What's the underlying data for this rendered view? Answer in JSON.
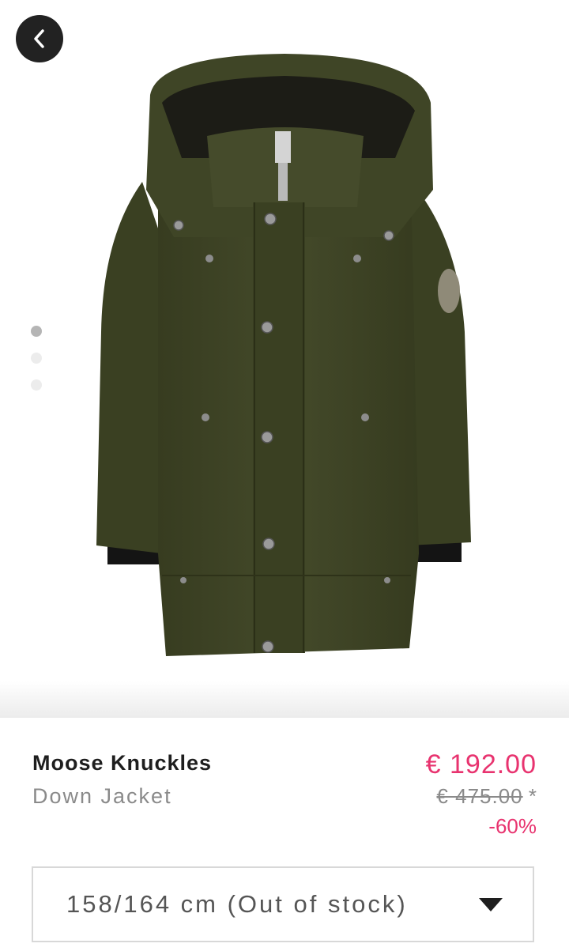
{
  "navigation": {
    "back_icon": "chevron-left-icon"
  },
  "gallery": {
    "image_description": "olive green hooded down parka",
    "total_images": 3,
    "active_index": 0
  },
  "product": {
    "brand": "Moose Knuckles",
    "name": "Down Jacket",
    "price_current": "€ 192.00",
    "price_original": "€ 475.00",
    "price_footnote": "*",
    "discount": "-60%"
  },
  "size_selector": {
    "selected": "158/164 cm (Out of stock)",
    "icon": "caret-down-icon"
  },
  "colors": {
    "accent": "#e8336f",
    "text_primary": "#1e1e1e",
    "text_secondary": "#8a8a8a",
    "jacket": "#3f4526"
  }
}
